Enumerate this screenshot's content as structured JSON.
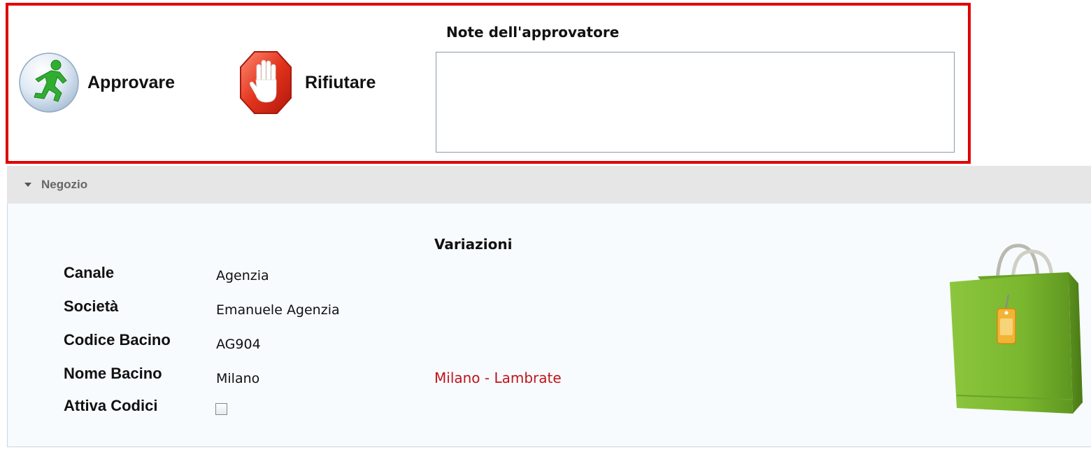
{
  "approval": {
    "approve_label": "Approvare",
    "reject_label": "Rifiutare",
    "notes_label": "Note dell'approvatore",
    "notes_value": "",
    "approve_icon": "running-man-icon",
    "reject_icon": "stop-hand-icon",
    "highlight_color": "#e00000"
  },
  "section": {
    "title": "Negozio",
    "expanded": true,
    "variations_title": "Variazioni",
    "icon": "shopping-bag-icon",
    "fields": [
      {
        "label": "Canale",
        "value": "Agenzia",
        "change": ""
      },
      {
        "label": "Società",
        "value": "Emanuele Agenzia",
        "change": ""
      },
      {
        "label": "Codice Bacino",
        "value": "AG904",
        "change": ""
      },
      {
        "label": "Nome Bacino",
        "value": "Milano",
        "change": "Milano - Lambrate"
      },
      {
        "label": "Attiva Codici",
        "checked": false
      }
    ],
    "change_color": "#c0141c"
  }
}
